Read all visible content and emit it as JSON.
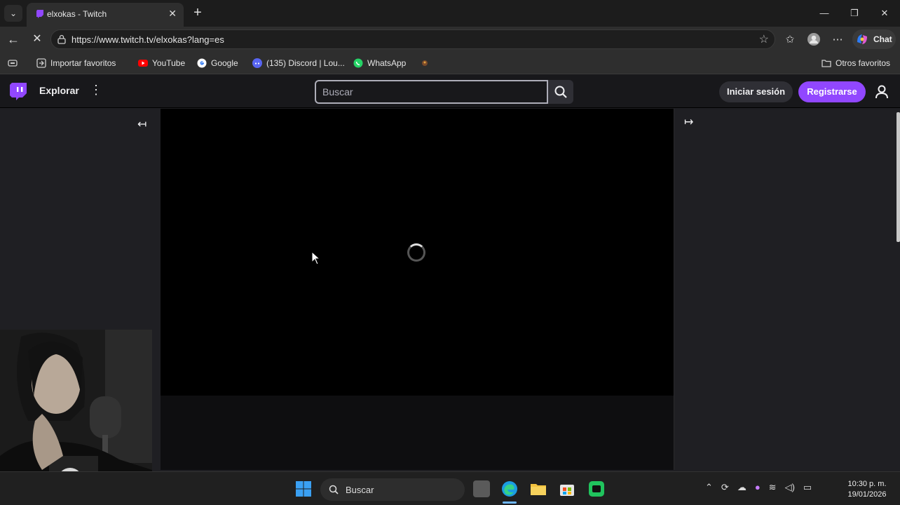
{
  "browser": {
    "tab_title": "elxokas - Twitch",
    "url": "https://www.twitch.tv/elxokas?lang=es",
    "chat_label": "Chat",
    "new_tab_symbol": "+",
    "bookmarks": [
      {
        "label": "Importar favoritos",
        "icon": "import-icon"
      },
      {
        "label": "YouTube",
        "icon": "youtube-icon"
      },
      {
        "label": "Google",
        "icon": "google-icon"
      },
      {
        "label": "(135) Discord | Lou...",
        "icon": "discord-icon"
      },
      {
        "label": "WhatsApp",
        "icon": "whatsapp-icon"
      }
    ],
    "other_bookmarks": "Otros favoritos"
  },
  "twitch": {
    "explore": "Explorar",
    "search_placeholder": "Buscar",
    "login": "Iniciar sesión",
    "signup": "Registrarse",
    "accent_color": "#9147ff"
  },
  "taskbar": {
    "search_label": "Buscar",
    "time": "10:30 p. m.",
    "date": "19/01/2026"
  }
}
